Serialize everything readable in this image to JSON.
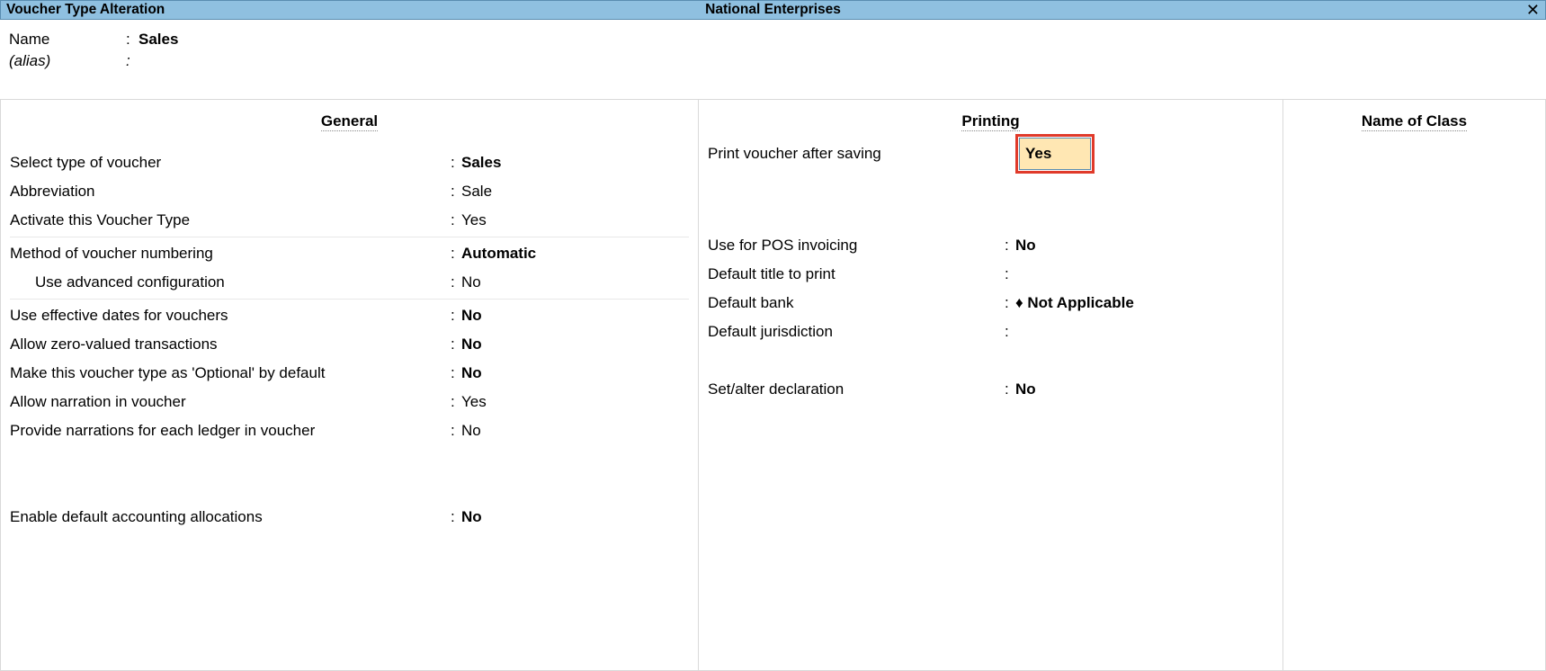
{
  "titlebar": {
    "title": "Voucher Type Alteration",
    "company": "National Enterprises",
    "close_glyph": "✕"
  },
  "header": {
    "name_label": "Name",
    "name_value": "Sales",
    "alias_label": "(alias)"
  },
  "general": {
    "heading": "General",
    "select_type_label": "Select type of voucher",
    "select_type_value": "Sales",
    "abbrev_label": "Abbreviation",
    "abbrev_value": "Sale",
    "activate_label": "Activate this Voucher Type",
    "activate_value": "Yes",
    "method_label": "Method of voucher numbering",
    "method_value": "Automatic",
    "adv_config_label": "Use advanced configuration",
    "adv_config_value": "No",
    "eff_dates_label": "Use effective dates for vouchers",
    "eff_dates_value": "No",
    "zero_val_label": "Allow zero-valued transactions",
    "zero_val_value": "No",
    "optional_label": "Make this voucher type as 'Optional' by default",
    "optional_value": "No",
    "narration_label": "Allow narration in voucher",
    "narration_value": "Yes",
    "narrations_ledger_label": "Provide narrations for each ledger in voucher",
    "narrations_ledger_value": "No",
    "enable_alloc_label": "Enable default accounting allocations",
    "enable_alloc_value": "No"
  },
  "printing": {
    "heading": "Printing",
    "print_after_save_label": "Print voucher after saving",
    "print_after_save_value": "Yes",
    "pos_label": "Use for POS invoicing",
    "pos_value": "No",
    "default_title_label": "Default title to print",
    "default_title_value": "",
    "default_bank_label": "Default bank",
    "default_bank_value": "♦ Not Applicable",
    "default_juris_label": "Default jurisdiction",
    "default_juris_value": "",
    "set_decl_label": "Set/alter declaration",
    "set_decl_value": "No"
  },
  "class": {
    "heading": "Name of Class"
  }
}
